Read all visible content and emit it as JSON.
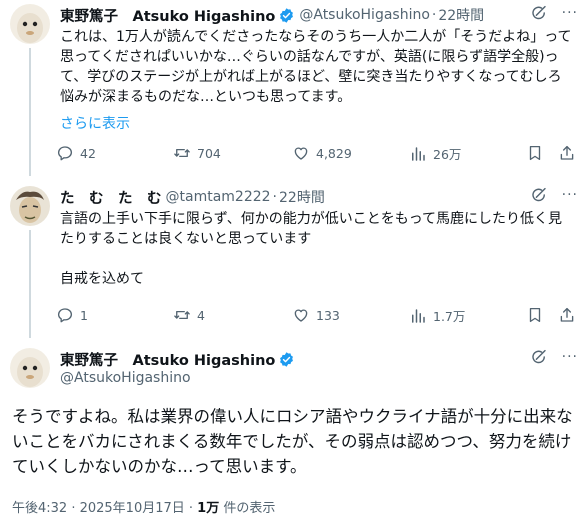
{
  "tweets": [
    {
      "display_name": "東野篤子　Atsuko Higashino",
      "handle": "@AtsukoHigashino",
      "time": "22時間",
      "body": "これは、1万人が読んでくださったならそのうち一人か二人が「そうだよね」って思ってくだされぱいいかな…ぐらいの話なんですが、英語(に限らず語学全般)って、学びのステージが上がれば上がるほど、壁に突き当たりやすくなってむしろ悩みが深まるものだな…といつも思ってます。",
      "show_more": "さらに表示",
      "stats": {
        "replies": "42",
        "reposts": "704",
        "likes": "4,829",
        "views": "26万"
      }
    },
    {
      "display_name": "た　む　た　む",
      "handle": "@tamtam2222",
      "time": "22時間",
      "body": "言語の上手い下手に限らず、何かの能力が低いことをもって馬鹿にしたり低く見たりすることは良くないと思っています\n\n自戒を込めて",
      "stats": {
        "replies": "1",
        "reposts": "4",
        "likes": "133",
        "views": "1.7万"
      }
    }
  ],
  "main_tweet": {
    "display_name": "東野篤子　Atsuko Higashino",
    "handle": "@AtsukoHigashino",
    "body": "そうですよね。私は業界の偉い人にロシア語やウクライナ語が十分に出来ないことをバカにされまくる数年でしたが、その弱点は認めつつ、努力を続けていくしかないのかな…って思います。",
    "timestamp": "午後4:32 · 2025年10月17日 · ",
    "views_count": "1万",
    "views_label": " 件の表示"
  },
  "more_label": "···",
  "dot_sep": "·",
  "colors": {
    "verified": "#1d9bf0",
    "secondary_text": "#536471",
    "link": "#1d9bf0",
    "thread_line": "#cfd9de"
  },
  "icons": [
    "reply-icon",
    "repost-icon",
    "like-icon",
    "views-icon",
    "bookmark-icon",
    "share-icon",
    "grok-icon",
    "verified-badge-icon"
  ]
}
